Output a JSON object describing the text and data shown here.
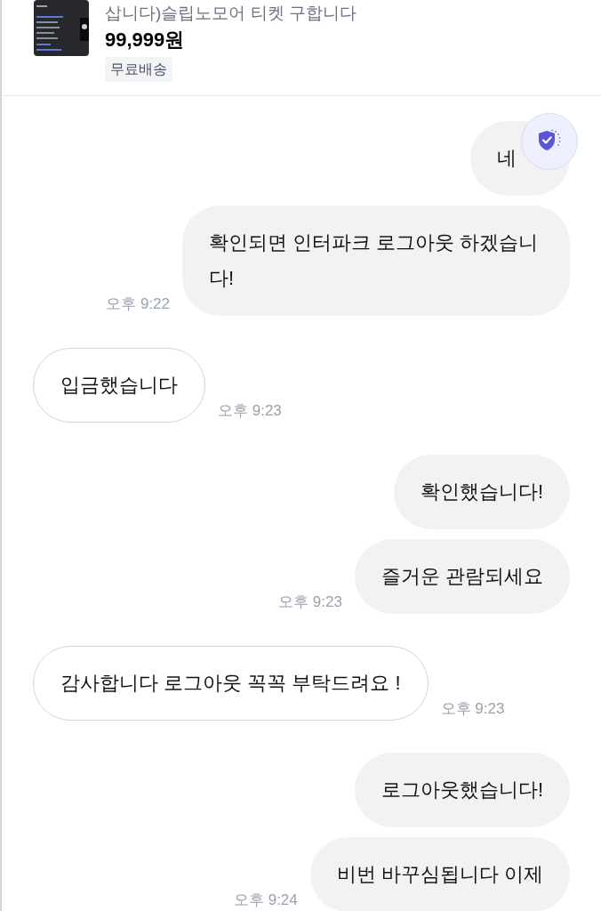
{
  "product": {
    "title": "삽니다)슬립노모어 티켓 구합니다",
    "price": "99,999원",
    "tag": "무료배송"
  },
  "messages": [
    {
      "kind": "sent",
      "bubbles": [
        "네",
        "확인되면 인터파크 로그아웃 하겠습니다!"
      ],
      "time": "오후 9:22"
    },
    {
      "kind": "received",
      "bubbles": [
        "입금했습니다"
      ],
      "time": "오후 9:23"
    },
    {
      "kind": "sent",
      "bubbles": [
        "확인했습니다!",
        "즐거운 관람되세요"
      ],
      "time": "오후 9:23"
    },
    {
      "kind": "received",
      "bubbles": [
        "감사합니다 로그아웃 꼭꼭 부탁드려요 !"
      ],
      "time": "오후 9:23"
    },
    {
      "kind": "sent",
      "bubbles": [
        "로그아웃했습니다!",
        "비번 바꾸심됩니다 이제"
      ],
      "time": "오후 9:24"
    }
  ]
}
